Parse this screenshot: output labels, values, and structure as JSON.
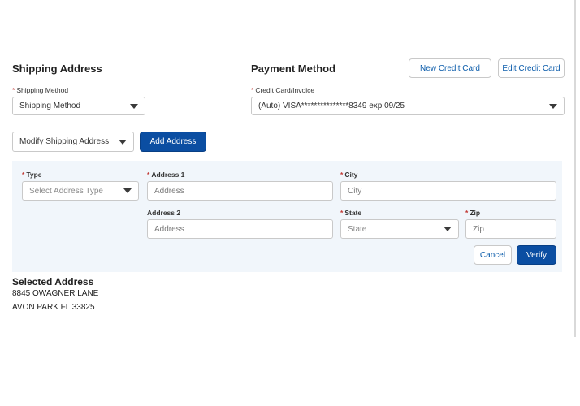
{
  "shipping": {
    "title": "Shipping Address",
    "method_label": "Shipping Method",
    "method_value": "Shipping Method",
    "modify_value": "Modify Shipping Address",
    "add_address_label": "Add Address"
  },
  "payment": {
    "title": "Payment Method",
    "new_card_label": "New Credit Card",
    "edit_card_label": "Edit Credit Card",
    "card_label": "Credit Card/Invoice",
    "card_value": "(Auto) VISA***************8349 exp 09/25"
  },
  "address_form": {
    "type_label": "Type",
    "type_placeholder": "Select Address Type",
    "address1_label": "Address 1",
    "address1_placeholder": "Address",
    "city_label": "City",
    "city_placeholder": "City",
    "address2_label": "Address 2",
    "address2_placeholder": "Address",
    "state_label": "State",
    "state_placeholder": "State",
    "zip_label": "Zip",
    "zip_placeholder": "Zip",
    "cancel_label": "Cancel",
    "verify_label": "Verify"
  },
  "selected_address": {
    "title": "Selected Address",
    "line1": "8845 OWAGNER LANE",
    "line2": "AVON PARK FL 33825"
  },
  "required_marker": "*",
  "colors": {
    "primary": "#0b4ea2",
    "link": "#0b5cab",
    "panel": "#f1f6fb",
    "border": "#c9c9c9"
  }
}
